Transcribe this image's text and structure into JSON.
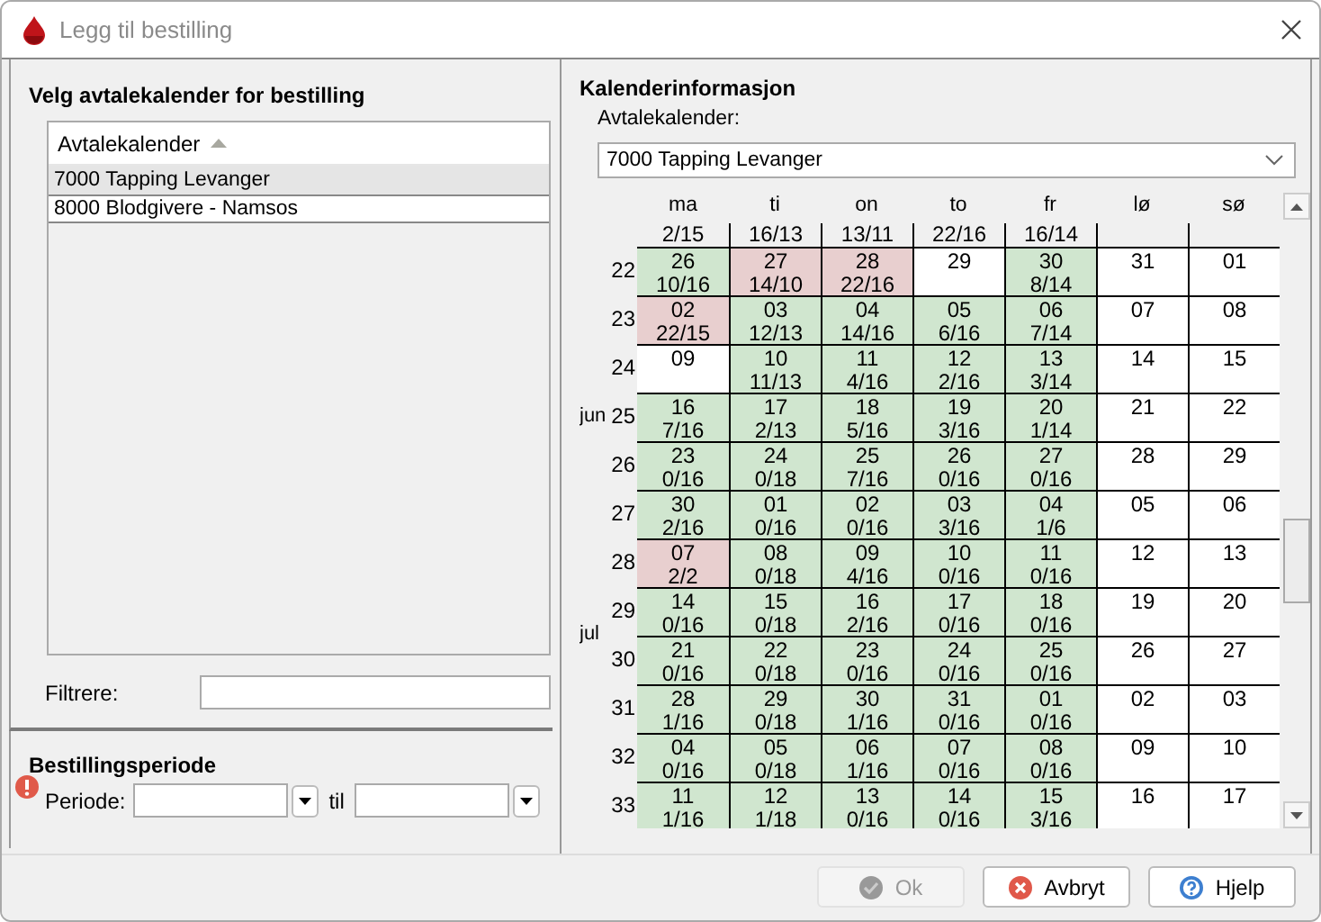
{
  "window": {
    "title": "Legg til bestilling"
  },
  "calendar_list": {
    "heading": "Velg avtalekalender for bestilling",
    "column": "Avtalekalender",
    "sort_ascending": true,
    "rows": [
      {
        "label": "7000 Tapping Levanger",
        "selected": true
      },
      {
        "label": "8000 Blodgivere - Namsos",
        "selected": false
      }
    ],
    "filter_label": "Filtrere:"
  },
  "period": {
    "heading": "Bestillingsperiode",
    "error": true,
    "label": "Periode:",
    "separator": "til"
  },
  "calendar_info": {
    "heading": "Kalenderinformasjon",
    "label": "Avtalekalender:",
    "value": "7000 Tapping Levanger",
    "weekdays": [
      "ma",
      "ti",
      "on",
      "to",
      "fr",
      "lø",
      "sø"
    ],
    "weeks": [
      {
        "days": [
          {
            "count": "2/15"
          },
          {
            "count": "16/13"
          },
          {
            "count": "13/11"
          },
          {
            "count": "22/16"
          },
          {
            "count": "16/14"
          }
        ]
      },
      {
        "week": "22",
        "days": [
          {
            "day": "26",
            "count": "10/16",
            "color": "#d0e6cf"
          },
          {
            "day": "27",
            "count": "14/10",
            "color": "#e8cfcf"
          },
          {
            "day": "28",
            "count": "22/16",
            "color": "#e8cfcf"
          },
          {
            "day": "29",
            "color": "#ffffff"
          },
          {
            "day": "30",
            "count": "8/14",
            "color": "#d0e6cf"
          },
          {
            "day": "31",
            "color": "#ffffff"
          },
          {
            "day": "01",
            "color": "#ffffff"
          }
        ]
      },
      {
        "week": "23",
        "days": [
          {
            "day": "02",
            "count": "22/15",
            "color": "#e8cfcf"
          },
          {
            "day": "03",
            "count": "12/13",
            "color": "#d0e6cf"
          },
          {
            "day": "04",
            "count": "14/16",
            "color": "#d0e6cf"
          },
          {
            "day": "05",
            "count": "6/16",
            "color": "#d0e6cf"
          },
          {
            "day": "06",
            "count": "7/14",
            "color": "#d0e6cf"
          },
          {
            "day": "07",
            "color": "#ffffff"
          },
          {
            "day": "08",
            "color": "#ffffff"
          }
        ]
      },
      {
        "week": "24",
        "days": [
          {
            "day": "09",
            "color": "#ffffff"
          },
          {
            "day": "10",
            "count": "11/13",
            "color": "#d0e6cf"
          },
          {
            "day": "11",
            "count": "4/16",
            "color": "#d0e6cf"
          },
          {
            "day": "12",
            "count": "2/16",
            "color": "#d0e6cf"
          },
          {
            "day": "13",
            "count": "3/14",
            "color": "#d0e6cf"
          },
          {
            "day": "14",
            "color": "#ffffff"
          },
          {
            "day": "15",
            "color": "#ffffff"
          }
        ]
      },
      {
        "week": "25",
        "month": "jun",
        "days": [
          {
            "day": "16",
            "count": "7/16",
            "color": "#d0e6cf"
          },
          {
            "day": "17",
            "count": "2/13",
            "color": "#d0e6cf"
          },
          {
            "day": "18",
            "count": "5/16",
            "color": "#d0e6cf"
          },
          {
            "day": "19",
            "count": "3/16",
            "color": "#d0e6cf"
          },
          {
            "day": "20",
            "count": "1/14",
            "color": "#d0e6cf"
          },
          {
            "day": "21",
            "color": "#ffffff"
          },
          {
            "day": "22",
            "color": "#ffffff"
          }
        ]
      },
      {
        "week": "26",
        "days": [
          {
            "day": "23",
            "count": "0/16",
            "color": "#d0e6cf"
          },
          {
            "day": "24",
            "count": "0/18",
            "color": "#d0e6cf"
          },
          {
            "day": "25",
            "count": "7/16",
            "color": "#d0e6cf"
          },
          {
            "day": "26",
            "count": "0/16",
            "color": "#d0e6cf"
          },
          {
            "day": "27",
            "count": "0/16",
            "color": "#d0e6cf"
          },
          {
            "day": "28",
            "color": "#ffffff"
          },
          {
            "day": "29",
            "color": "#ffffff"
          }
        ]
      },
      {
        "week": "27",
        "days": [
          {
            "day": "30",
            "count": "2/16",
            "color": "#d0e6cf"
          },
          {
            "day": "01",
            "count": "0/16",
            "color": "#d0e6cf"
          },
          {
            "day": "02",
            "count": "0/16",
            "color": "#d0e6cf"
          },
          {
            "day": "03",
            "count": "3/16",
            "color": "#d0e6cf"
          },
          {
            "day": "04",
            "count": "1/6",
            "color": "#d0e6cf"
          },
          {
            "day": "05",
            "color": "#ffffff"
          },
          {
            "day": "06",
            "color": "#ffffff"
          }
        ]
      },
      {
        "week": "28",
        "days": [
          {
            "day": "07",
            "count": "2/2",
            "color": "#e8cfcf"
          },
          {
            "day": "08",
            "count": "0/18",
            "color": "#d0e6cf"
          },
          {
            "day": "09",
            "count": "4/16",
            "color": "#d0e6cf"
          },
          {
            "day": "10",
            "count": "0/16",
            "color": "#d0e6cf"
          },
          {
            "day": "11",
            "count": "0/16",
            "color": "#d0e6cf"
          },
          {
            "day": "12",
            "color": "#ffffff"
          },
          {
            "day": "13",
            "color": "#ffffff"
          }
        ]
      },
      {
        "week": "29",
        "month": "jul",
        "days": [
          {
            "day": "14",
            "count": "0/16",
            "color": "#d0e6cf"
          },
          {
            "day": "15",
            "count": "0/18",
            "color": "#d0e6cf"
          },
          {
            "day": "16",
            "count": "2/16",
            "color": "#d0e6cf"
          },
          {
            "day": "17",
            "count": "0/16",
            "color": "#d0e6cf"
          },
          {
            "day": "18",
            "count": "0/16",
            "color": "#d0e6cf"
          },
          {
            "day": "19",
            "color": "#ffffff"
          },
          {
            "day": "20",
            "color": "#ffffff"
          }
        ]
      },
      {
        "week": "30",
        "days": [
          {
            "day": "21",
            "count": "0/16",
            "color": "#d0e6cf"
          },
          {
            "day": "22",
            "count": "0/18",
            "color": "#d0e6cf"
          },
          {
            "day": "23",
            "count": "0/16",
            "color": "#d0e6cf"
          },
          {
            "day": "24",
            "count": "0/16",
            "color": "#d0e6cf"
          },
          {
            "day": "25",
            "count": "0/16",
            "color": "#d0e6cf"
          },
          {
            "day": "26",
            "color": "#ffffff"
          },
          {
            "day": "27",
            "color": "#ffffff"
          }
        ]
      },
      {
        "week": "31",
        "days": [
          {
            "day": "28",
            "count": "1/16",
            "color": "#d0e6cf"
          },
          {
            "day": "29",
            "count": "0/18",
            "color": "#d0e6cf"
          },
          {
            "day": "30",
            "count": "1/16",
            "color": "#d0e6cf"
          },
          {
            "day": "31",
            "count": "0/16",
            "color": "#d0e6cf"
          },
          {
            "day": "01",
            "count": "0/16",
            "color": "#d0e6cf"
          },
          {
            "day": "02",
            "color": "#ffffff"
          },
          {
            "day": "03",
            "color": "#ffffff"
          }
        ]
      },
      {
        "week": "32",
        "days": [
          {
            "day": "04",
            "count": "0/16",
            "color": "#d0e6cf"
          },
          {
            "day": "05",
            "count": "0/18",
            "color": "#d0e6cf"
          },
          {
            "day": "06",
            "count": "1/16",
            "color": "#d0e6cf"
          },
          {
            "day": "07",
            "count": "0/16",
            "color": "#d0e6cf"
          },
          {
            "day": "08",
            "count": "0/16",
            "color": "#d0e6cf"
          },
          {
            "day": "09",
            "color": "#ffffff"
          },
          {
            "day": "10",
            "color": "#ffffff"
          }
        ]
      },
      {
        "week": "33",
        "days": [
          {
            "day": "11",
            "count": "1/16",
            "color": "#d0e6cf"
          },
          {
            "day": "12",
            "count": "1/18",
            "color": "#d0e6cf"
          },
          {
            "day": "13",
            "count": "0/16",
            "color": "#d0e6cf"
          },
          {
            "day": "14",
            "count": "0/16",
            "color": "#d0e6cf"
          },
          {
            "day": "15",
            "count": "3/16",
            "color": "#d0e6cf"
          },
          {
            "day": "16",
            "color": "#ffffff"
          },
          {
            "day": "17",
            "color": "#ffffff"
          }
        ]
      }
    ]
  },
  "buttons": [
    {
      "label": "Ok",
      "kind": "ok",
      "disabled": true
    },
    {
      "label": "Avbryt",
      "kind": "cancel",
      "disabled": false
    },
    {
      "label": "Hjelp",
      "kind": "help",
      "disabled": false
    }
  ]
}
